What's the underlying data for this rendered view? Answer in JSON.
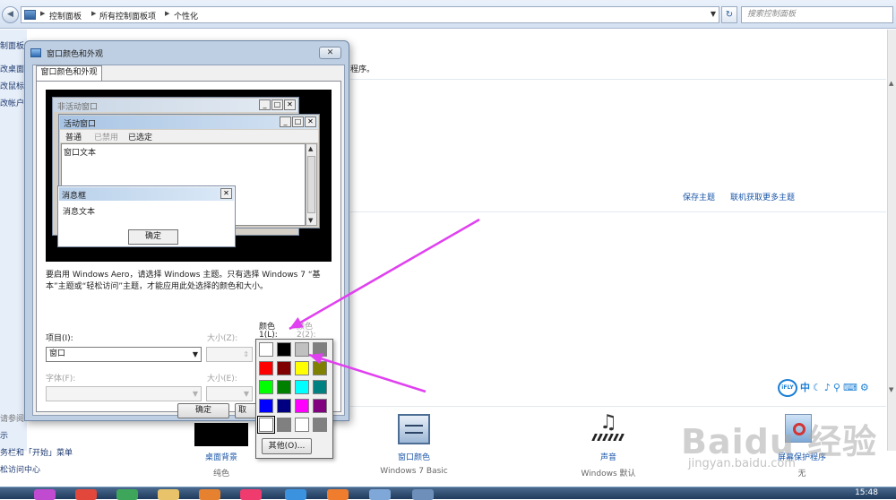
{
  "explorer": {
    "breadcrumb": [
      "控制面板",
      "所有控制面板项",
      "个性化"
    ],
    "search_placeholder": "搜索控制面板",
    "left_links": [
      "制面板",
      "改桌面",
      "改鼠标",
      "改帐户"
    ],
    "left_bottom": [
      "请参阅",
      "示",
      "务栏和「开始」菜单",
      "松访问中心"
    ],
    "intro_fragment": "程序。",
    "save_theme": "保存主题",
    "get_more_themes": "联机获取更多主题",
    "tiles": [
      {
        "label": "桌面背景",
        "sub": "纯色"
      },
      {
        "label": "窗口颜色",
        "sub": "Windows 7 Basic"
      },
      {
        "label": "声音",
        "sub": "Windows 默认"
      },
      {
        "label": "屏幕保护程序",
        "sub": "无"
      }
    ],
    "ime": [
      "iFLY",
      "中",
      "☾",
      "♪",
      "⚲",
      "⌨",
      "⚙"
    ],
    "watermark": "Baidu 经验",
    "watermark_url": "jingyan.baidu.com",
    "clock": "15:48"
  },
  "dialog": {
    "title": "窗口颜色和外观",
    "close_glyph": "✕",
    "tab": "窗口颜色和外观",
    "preview": {
      "inactive_title": "非活动窗口",
      "active_title": "活动窗口",
      "menu": [
        "普通",
        "已禁用",
        "已选定"
      ],
      "window_text": "窗口文本",
      "msgbox_title": "消息框",
      "msgbox_text": "消息文本",
      "ok": "确定"
    },
    "description": "要启用 Windows Aero，请选择 Windows 主题。只有选择 Windows 7 “基本”主题或“轻松访问”主题，才能应用此处选择的颜色和大小。",
    "item_label": "项目(I):",
    "item_value": "窗口",
    "size_label_1": "大小(Z):",
    "color1_label_a": "颜色",
    "color1_label_b": "1(L):",
    "color2_label_a": "颜色",
    "color2_label_b": "2(2):",
    "font_label": "字体(F):",
    "size_label_2": "大小(E):",
    "ok": "确定",
    "cancel_fragment": "取"
  },
  "palette": {
    "colors": [
      "#ffffff",
      "#000000",
      "#c0c0c0",
      "#808080",
      "#ff0000",
      "#800000",
      "#ffff00",
      "#808000",
      "#00ff00",
      "#008000",
      "#00ffff",
      "#008080",
      "#0000ff",
      "#000080",
      "#ff00ff",
      "#800080",
      "#ffffff",
      "#808080",
      "#ffffff",
      "#808080"
    ],
    "selected_index": 16,
    "other": "其他(O)..."
  },
  "annotation_color": "#e040f0"
}
